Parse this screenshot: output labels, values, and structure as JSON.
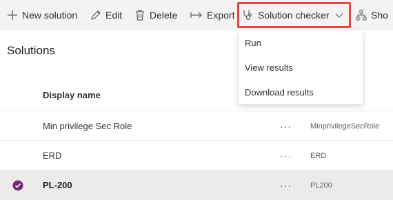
{
  "toolbar": {
    "new_solution": "New solution",
    "edit": "Edit",
    "delete": "Delete",
    "export": "Export",
    "solution_checker": "Solution checker",
    "show": "Sho"
  },
  "page": {
    "title": "Solutions"
  },
  "table": {
    "column_display_name": "Display name",
    "more_glyph": "···",
    "rows": [
      {
        "display_name": "Min privilege Sec Role",
        "unique_name": "MinprivilegeSecRole",
        "selected": false
      },
      {
        "display_name": "ERD",
        "unique_name": "ERD",
        "selected": false
      },
      {
        "display_name": "PL-200",
        "unique_name": "PL200",
        "selected": true
      }
    ]
  },
  "checker_menu": {
    "items": [
      "Run",
      "View results",
      "Download results"
    ]
  },
  "colors": {
    "toolbar_bg": "#f4f3f2",
    "highlight": "#e04848",
    "selected_check": "#742774",
    "selected_row_bg": "#edebe9"
  },
  "icons": {
    "new_solution": "plus-icon",
    "edit": "pencil-icon",
    "delete": "trash-icon",
    "export": "arrow-right-icon",
    "solution_checker": "stethoscope-icon",
    "checker_dropdown": "chevron-down-icon",
    "show": "hierarchy-icon",
    "row_selected": "check-circle-icon"
  }
}
